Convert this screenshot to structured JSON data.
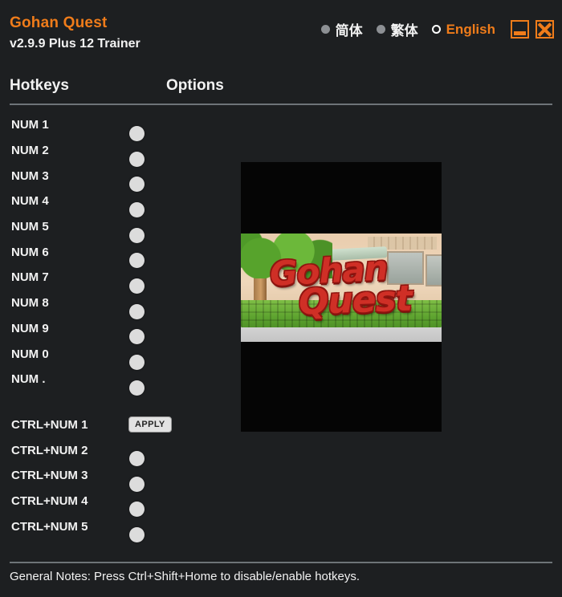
{
  "window": {
    "background_color": "#1d1f21",
    "accent_color": "#f07c1a",
    "text_color": "#f2f2f2"
  },
  "header": {
    "game_title": "Gohan Quest",
    "trainer_version": "v2.9.9 Plus 12 Trainer",
    "languages": [
      {
        "label": "简体",
        "selected": false
      },
      {
        "label": "繁体",
        "selected": false
      },
      {
        "label": "English",
        "selected": true
      }
    ],
    "minimize_icon": "minimize-icon",
    "close_icon": "close-icon"
  },
  "columns": {
    "hotkeys_header": "Hotkeys",
    "options_header": "Options"
  },
  "rows": [
    {
      "hotkey": "NUM 1",
      "control": "toggle",
      "state": "off"
    },
    {
      "hotkey": "NUM 2",
      "control": "toggle",
      "state": "off"
    },
    {
      "hotkey": "NUM 3",
      "control": "toggle",
      "state": "off"
    },
    {
      "hotkey": "NUM 4",
      "control": "toggle",
      "state": "off"
    },
    {
      "hotkey": "NUM 5",
      "control": "toggle",
      "state": "off"
    },
    {
      "hotkey": "NUM 6",
      "control": "toggle",
      "state": "off"
    },
    {
      "hotkey": "NUM 7",
      "control": "toggle",
      "state": "off"
    },
    {
      "hotkey": "NUM 8",
      "control": "toggle",
      "state": "off"
    },
    {
      "hotkey": "NUM 9",
      "control": "toggle",
      "state": "off"
    },
    {
      "hotkey": "NUM 0",
      "control": "toggle",
      "state": "off"
    },
    {
      "hotkey": "NUM .",
      "control": "toggle",
      "state": "off"
    },
    {
      "hotkey": "CTRL+NUM 1",
      "control": "button",
      "label": "APPLY"
    },
    {
      "hotkey": "CTRL+NUM 2",
      "control": "toggle",
      "state": "off"
    },
    {
      "hotkey": "CTRL+NUM 3",
      "control": "toggle",
      "state": "off"
    },
    {
      "hotkey": "CTRL+NUM 4",
      "control": "toggle",
      "state": "off"
    },
    {
      "hotkey": "CTRL+NUM 5",
      "control": "toggle",
      "state": "off"
    }
  ],
  "artwork": {
    "logo_line_1": "Gohan",
    "logo_line_2": "Quest"
  },
  "footer": {
    "general_notes": "General Notes: Press Ctrl+Shift+Home to disable/enable hotkeys."
  }
}
